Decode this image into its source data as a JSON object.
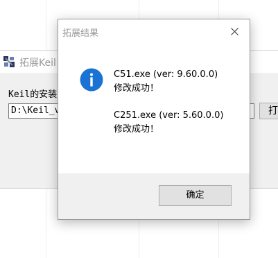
{
  "background_window": {
    "title": "拓展Keil",
    "install_label": "Keil的安装",
    "path_value": "D:\\Keil_v",
    "open_button_label": "打"
  },
  "dialog": {
    "title": "拓展结果",
    "icon": "info-icon",
    "lines": [
      "C51.exe (ver: 9.60.0.0)",
      "修改成功！",
      "C251.exe (ver: 5.60.0.0)",
      "修改成功！"
    ],
    "ok_label": "确定"
  },
  "colors": {
    "info_icon_fill": "#1a73d4",
    "dialog_button_area": "#f0f0f0",
    "title_text": "#999999"
  }
}
